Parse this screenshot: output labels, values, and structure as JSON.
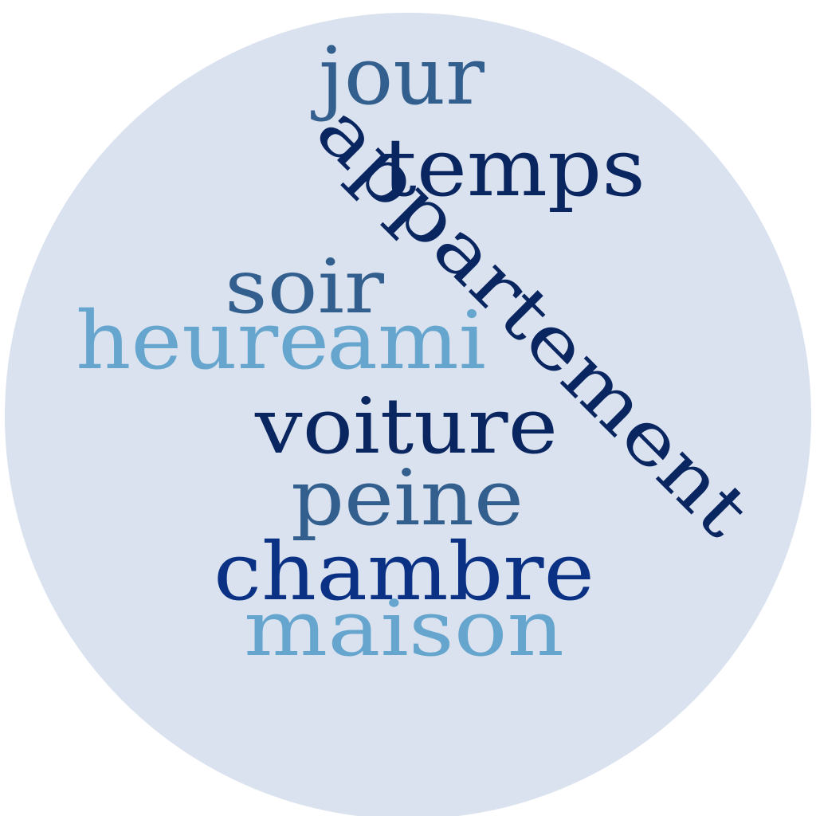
{
  "background": {
    "disk_color": "#dae2ef",
    "page_color": "#ffffff"
  },
  "palette": {
    "dark_navy": "#0a2660",
    "royal_blue": "#0a3184",
    "steel_blue": "#335f8e",
    "light_blue": "#66a5cd"
  },
  "words": [
    {
      "text": "jour",
      "color": "#335f8e"
    },
    {
      "text": "temps",
      "color": "#0a2660"
    },
    {
      "text": "appartement",
      "color": "#0a2660"
    },
    {
      "text": "soir",
      "color": "#335f8e"
    },
    {
      "text": "heure",
      "color": "#66a5cd"
    },
    {
      "text": "ami",
      "color": "#66a5cd"
    },
    {
      "text": "voiture",
      "color": "#0a2660"
    },
    {
      "text": "peine",
      "color": "#335f8e"
    },
    {
      "text": "chambre",
      "color": "#0a3184"
    },
    {
      "text": "maison",
      "color": "#66a5cd"
    }
  ]
}
